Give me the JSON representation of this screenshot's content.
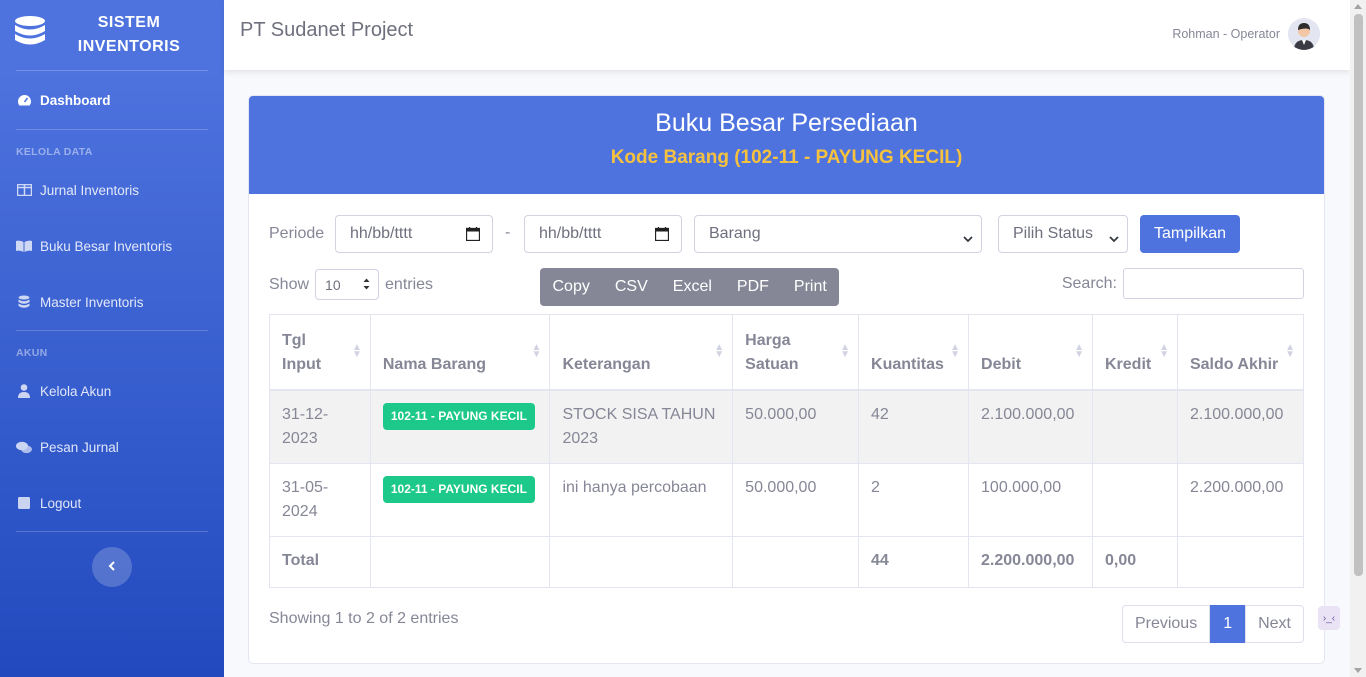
{
  "sidebar": {
    "brand_line1": "SISTEM",
    "brand_line2": "INVENTORIS",
    "dashboard": "Dashboard",
    "heading_kelola": "KELOLA DATA",
    "jurnal": "Jurnal Inventoris",
    "buku_besar": "Buku Besar Inventoris",
    "master": "Master Inventoris",
    "heading_akun": "AKUN",
    "kelola_akun": "Kelola Akun",
    "pesan_jurnal": "Pesan Jurnal",
    "logout": "Logout"
  },
  "topbar": {
    "project": "PT Sudanet Project",
    "user": "Rohman - Operator"
  },
  "card": {
    "title": "Buku Besar Persediaan",
    "subtitle": "Kode Barang (102-11 - PAYUNG KECIL)"
  },
  "filter": {
    "periode_label": "Periode",
    "date_from": "hh/bb/tttt",
    "date_sep": "-",
    "date_to": "hh/bb/tttt",
    "barang": "Barang",
    "status": "Pilih Status",
    "submit": "Tampilkan"
  },
  "controls": {
    "show": "Show",
    "length": "10",
    "entries": "entries",
    "buttons": [
      "Copy",
      "CSV",
      "Excel",
      "PDF",
      "Print"
    ],
    "search_label": "Search:"
  },
  "table": {
    "headers": [
      "Tgl Input",
      "Nama Barang",
      "Keterangan",
      "Harga Satuan",
      "Kuantitas",
      "Debit",
      "Kredit",
      "Saldo Akhir"
    ],
    "rows": [
      {
        "tgl": "31-12-2023",
        "barang": "102-11 - PAYUNG KECIL",
        "ket": "STOCK SISA TAHUN 2023",
        "harga": "50.000,00",
        "qty": "42",
        "debit": "2.100.000,00",
        "kredit": "",
        "saldo": "2.100.000,00"
      },
      {
        "tgl": "31-05-2024",
        "barang": "102-11 - PAYUNG KECIL",
        "ket": "ini hanya percobaan",
        "harga": "50.000,00",
        "qty": "2",
        "debit": "100.000,00",
        "kredit": "",
        "saldo": "2.200.000,00"
      }
    ],
    "footer": {
      "label": "Total",
      "qty": "44",
      "debit": "2.200.000,00",
      "kredit": "0,00"
    }
  },
  "pagination": {
    "info": "Showing 1 to 2 of 2 entries",
    "prev": "Previous",
    "page": "1",
    "next": "Next"
  },
  "colors": {
    "primary": "#4e73df",
    "success": "#1cc88a",
    "warning": "#f6c23e",
    "secondary": "#858796"
  }
}
